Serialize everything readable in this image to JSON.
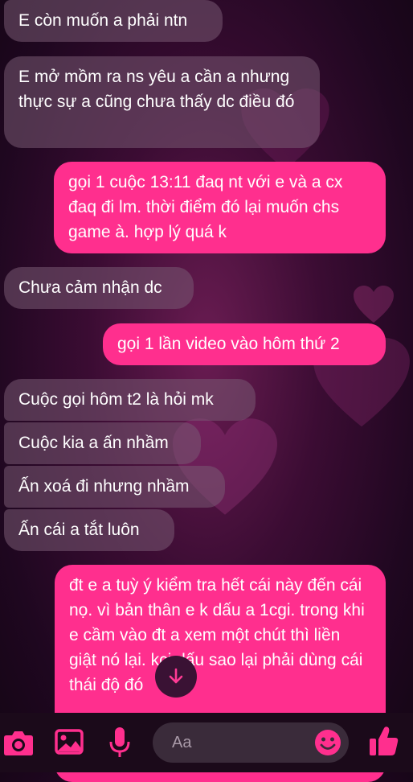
{
  "messages": [
    {
      "side": "in",
      "text": "E còn muốn a phải ntn"
    },
    {
      "side": "in",
      "text": "E mở mồm ra ns yêu a cần a nhưng thực sự a cũng chưa thấy dc điều đó"
    },
    {
      "side": "out",
      "text": "gọi 1 cuộc 13:11 đaq nt với e và a cx đaq đi lm. thời điểm đó lại muốn chs game à. hợp lý quá k"
    },
    {
      "side": "in",
      "text": "Chưa cảm nhận dc"
    },
    {
      "side": "out",
      "text": "gọi 1 lần video vào hôm thứ 2"
    },
    {
      "side": "in",
      "text": "Cuộc gọi hôm t2 là hỏi mk"
    },
    {
      "side": "in",
      "text": "Cuộc kia a ấn nhầm"
    },
    {
      "side": "in",
      "text": "Ấn xoá đi nhưng nhầm"
    },
    {
      "side": "in",
      "text": "Ấn cái a tắt luôn"
    },
    {
      "side": "out",
      "text": "đt e a tuỳ ý kiểm tra hết cái này đến cái nọ. vì bản thân e k dấu a 1cgi. trong khi e cầm vào đt a xem một chút thì liền giật nó lại. kcj dấu sao lại phải dùng cái thái độ đó"
    }
  ],
  "composer": {
    "placeholder": "Aa",
    "icons": [
      "camera-icon",
      "gallery-icon",
      "microphone-icon",
      "emoji-icon",
      "thumbs-up-icon"
    ]
  },
  "colors": {
    "accent": "#ff2f8e",
    "incoming": "#6e5a6c",
    "composer_bg": "#1b0a1a"
  }
}
